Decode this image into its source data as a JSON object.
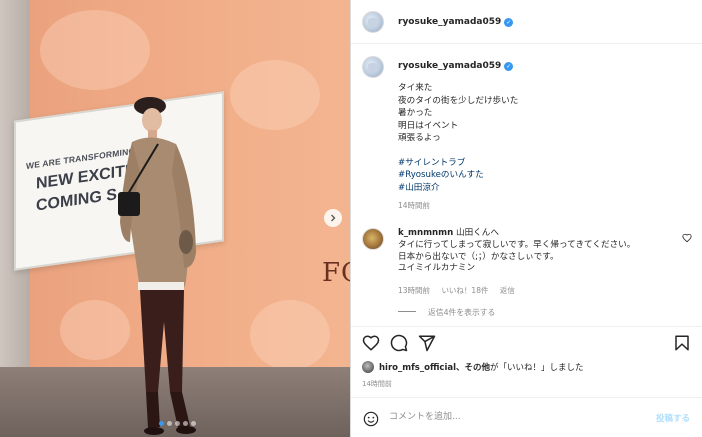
{
  "photo": {
    "billboard_small": "WE ARE TRANSFORMING THE",
    "billboard_line1": "NEW EXCITEM",
    "billboard_line2": "COMING S",
    "sign_text": "FO",
    "carousel_dots": 5,
    "active_dot": 0,
    "next_icon": "chevron-right-icon"
  },
  "header": {
    "username": "ryosuke_yamada059"
  },
  "caption": {
    "username": "ryosuke_yamada059",
    "lines": [
      "タイ来た",
      "夜のタイの街を少しだけ歩いた",
      "暑かった",
      "明日はイベント",
      "頑張るよっ"
    ],
    "hashtags": [
      "#サイレントラブ",
      "#Ryosukeのいんすた",
      "#山田涼介"
    ],
    "time": "14時間前"
  },
  "comment": {
    "username": "k_mnmnmn",
    "lines": [
      "山田くんへ",
      "タイに行ってしまって寂しいです。早く帰ってきてください。",
      "日本から出ないで（;；）かなさしぃです。",
      "ユイミイルカナミン"
    ],
    "time": "13時間前",
    "likes": "いいね！18件",
    "reply": "返信",
    "view_replies": "返信4件を表示する"
  },
  "likes": {
    "username": "hiro_mfs_official",
    "text_suffix": "、その他",
    "text_tail": "が「いいね！」しました",
    "time": "14時間前"
  },
  "add_comment": {
    "placeholder": "コメントを追加...",
    "post_label": "投稿する"
  },
  "colors": {
    "accent_blue": "#3897f0",
    "hashtag": "#00376b",
    "meta_gray": "#8e8e8e",
    "post_disabled": "#b2dffc"
  }
}
